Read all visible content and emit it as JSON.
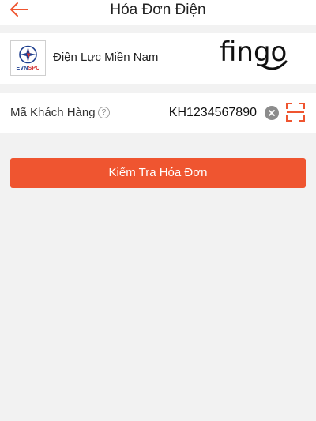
{
  "header": {
    "title": "Hóa Đơn Điện",
    "back_icon": "arrow-left-icon",
    "accent_color": "#ef5530"
  },
  "provider": {
    "logo_text_evn": "EVN",
    "logo_text_spc": "SPC",
    "name": "Điện Lực Miền Nam",
    "partner_logo": "fingo"
  },
  "customer": {
    "label": "Mã Khách Hàng",
    "help_icon": "?",
    "value": "KH1234567890"
  },
  "actions": {
    "check_label": "Kiểm Tra Hóa Đơn"
  }
}
